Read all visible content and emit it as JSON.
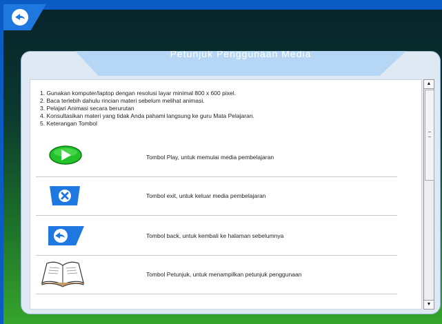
{
  "header": {
    "title": "Petunjuk Penggunaan Media"
  },
  "instructions": [
    "1. Gunakan komputer/laptop dengan resolusi layar minimal 800 x 600 pixel.",
    "2. Baca terlebih dahulu rincian materi sebelum melihat animasi.",
    "3. Pelajari Animasi secara berurutan",
    "4. Konsultasikan materi yang tidak Anda pahami langsung ke guru Mata Pelajaran.",
    "5. Keterangan Tombol"
  ],
  "buttons_legend": [
    {
      "icon": "play-icon",
      "description": "Tombol Play, untuk memulai media pembelajaran"
    },
    {
      "icon": "exit-icon",
      "description": "Tombol exit, untuk keluar media pembelajaran"
    },
    {
      "icon": "back-icon",
      "description": "Tombol back, untuk kembali ke halaman sebelumnya"
    },
    {
      "icon": "book-icon",
      "description": "Tombol Petunjuk, untuk menampilkan petunjuk penggunaan"
    }
  ],
  "colors": {
    "accent": "#1f78e0",
    "play_green": "#22c22a",
    "panel_tab": "#b5d7f5"
  }
}
